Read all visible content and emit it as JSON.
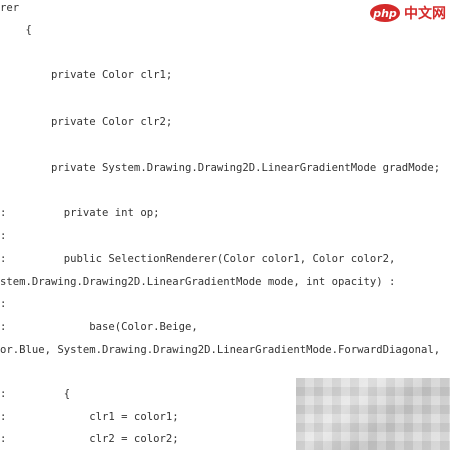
{
  "watermark": {
    "logo_text": "php",
    "site_text": "中文网"
  },
  "code_lines": [
    "rer",
    "    {",
    "        private Color clr1;",
    "        private Color clr2;",
    "        private System.Drawing.Drawing2D.LinearGradientMode gradMode;",
    ":         private int op;",
    ":",
    ":         public SelectionRenderer(Color color1, Color color2,",
    "stem.Drawing.Drawing2D.LinearGradientMode mode, int opacity) :",
    ":",
    ":             base(Color.Beige,",
    "or.Blue, System.Drawing.Drawing2D.LinearGradientMode.ForwardDiagonal,",
    ":         {",
    ":             clr1 = color1;",
    ":             clr2 = color2;"
  ]
}
